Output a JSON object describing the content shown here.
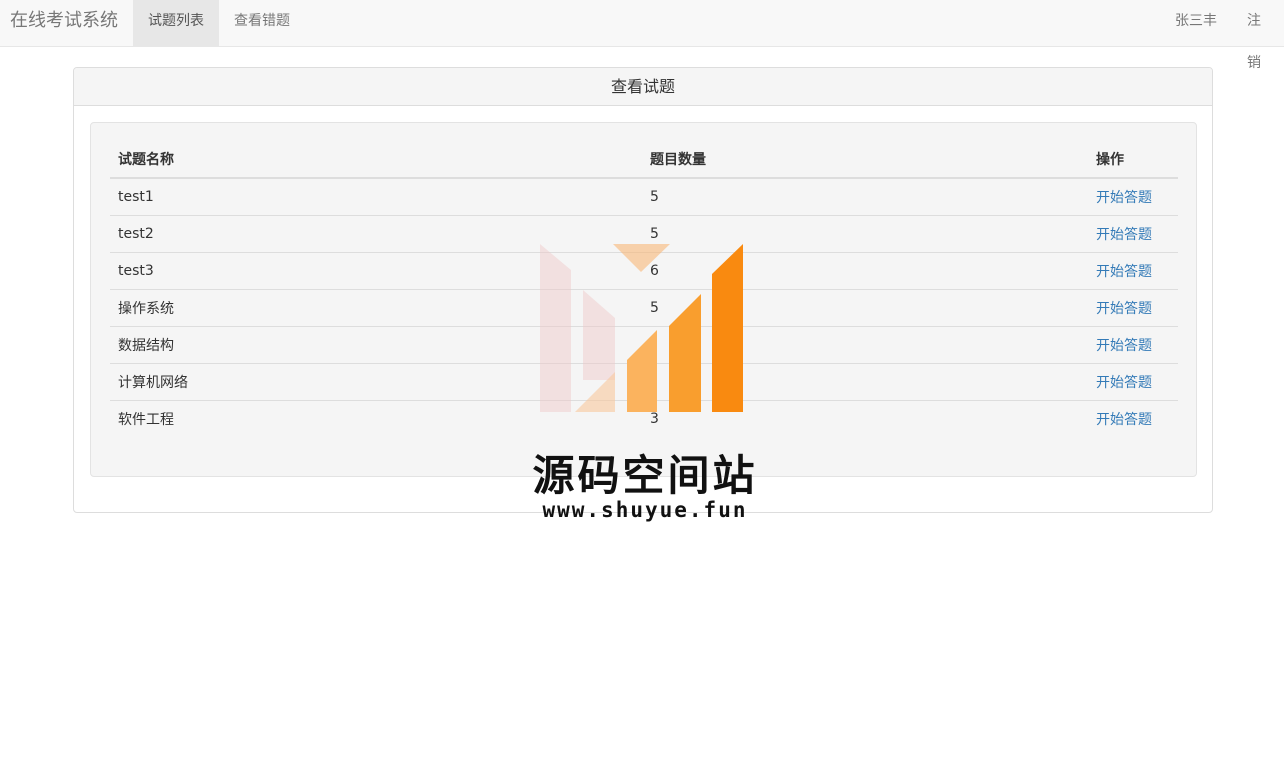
{
  "navbar": {
    "brand": "在线考试系统",
    "tabs": [
      {
        "label": "试题列表",
        "active": true
      },
      {
        "label": "查看错题",
        "active": false
      }
    ],
    "user": "张三丰",
    "logout": "注销"
  },
  "panel": {
    "title": "查看试题"
  },
  "table": {
    "headers": {
      "name": "试题名称",
      "count": "题目数量",
      "action": "操作"
    },
    "rows": [
      {
        "name": "test1",
        "count": "5",
        "action": "开始答题"
      },
      {
        "name": "test2",
        "count": "5",
        "action": "开始答题"
      },
      {
        "name": "test3",
        "count": "6",
        "action": "开始答题"
      },
      {
        "name": "操作系统",
        "count": "5",
        "action": "开始答题"
      },
      {
        "name": "数据结构",
        "count": "",
        "action": "开始答题"
      },
      {
        "name": "计算机网络",
        "count": "",
        "action": "开始答题"
      },
      {
        "name": "软件工程",
        "count": "3",
        "action": "开始答题"
      }
    ]
  },
  "watermark": {
    "title": "源码空间站",
    "url": "www.shuyue.fun"
  },
  "colors": {
    "link": "#337ab7",
    "navbar_bg": "#f8f8f8",
    "watermark_orange": "#f98a10"
  }
}
